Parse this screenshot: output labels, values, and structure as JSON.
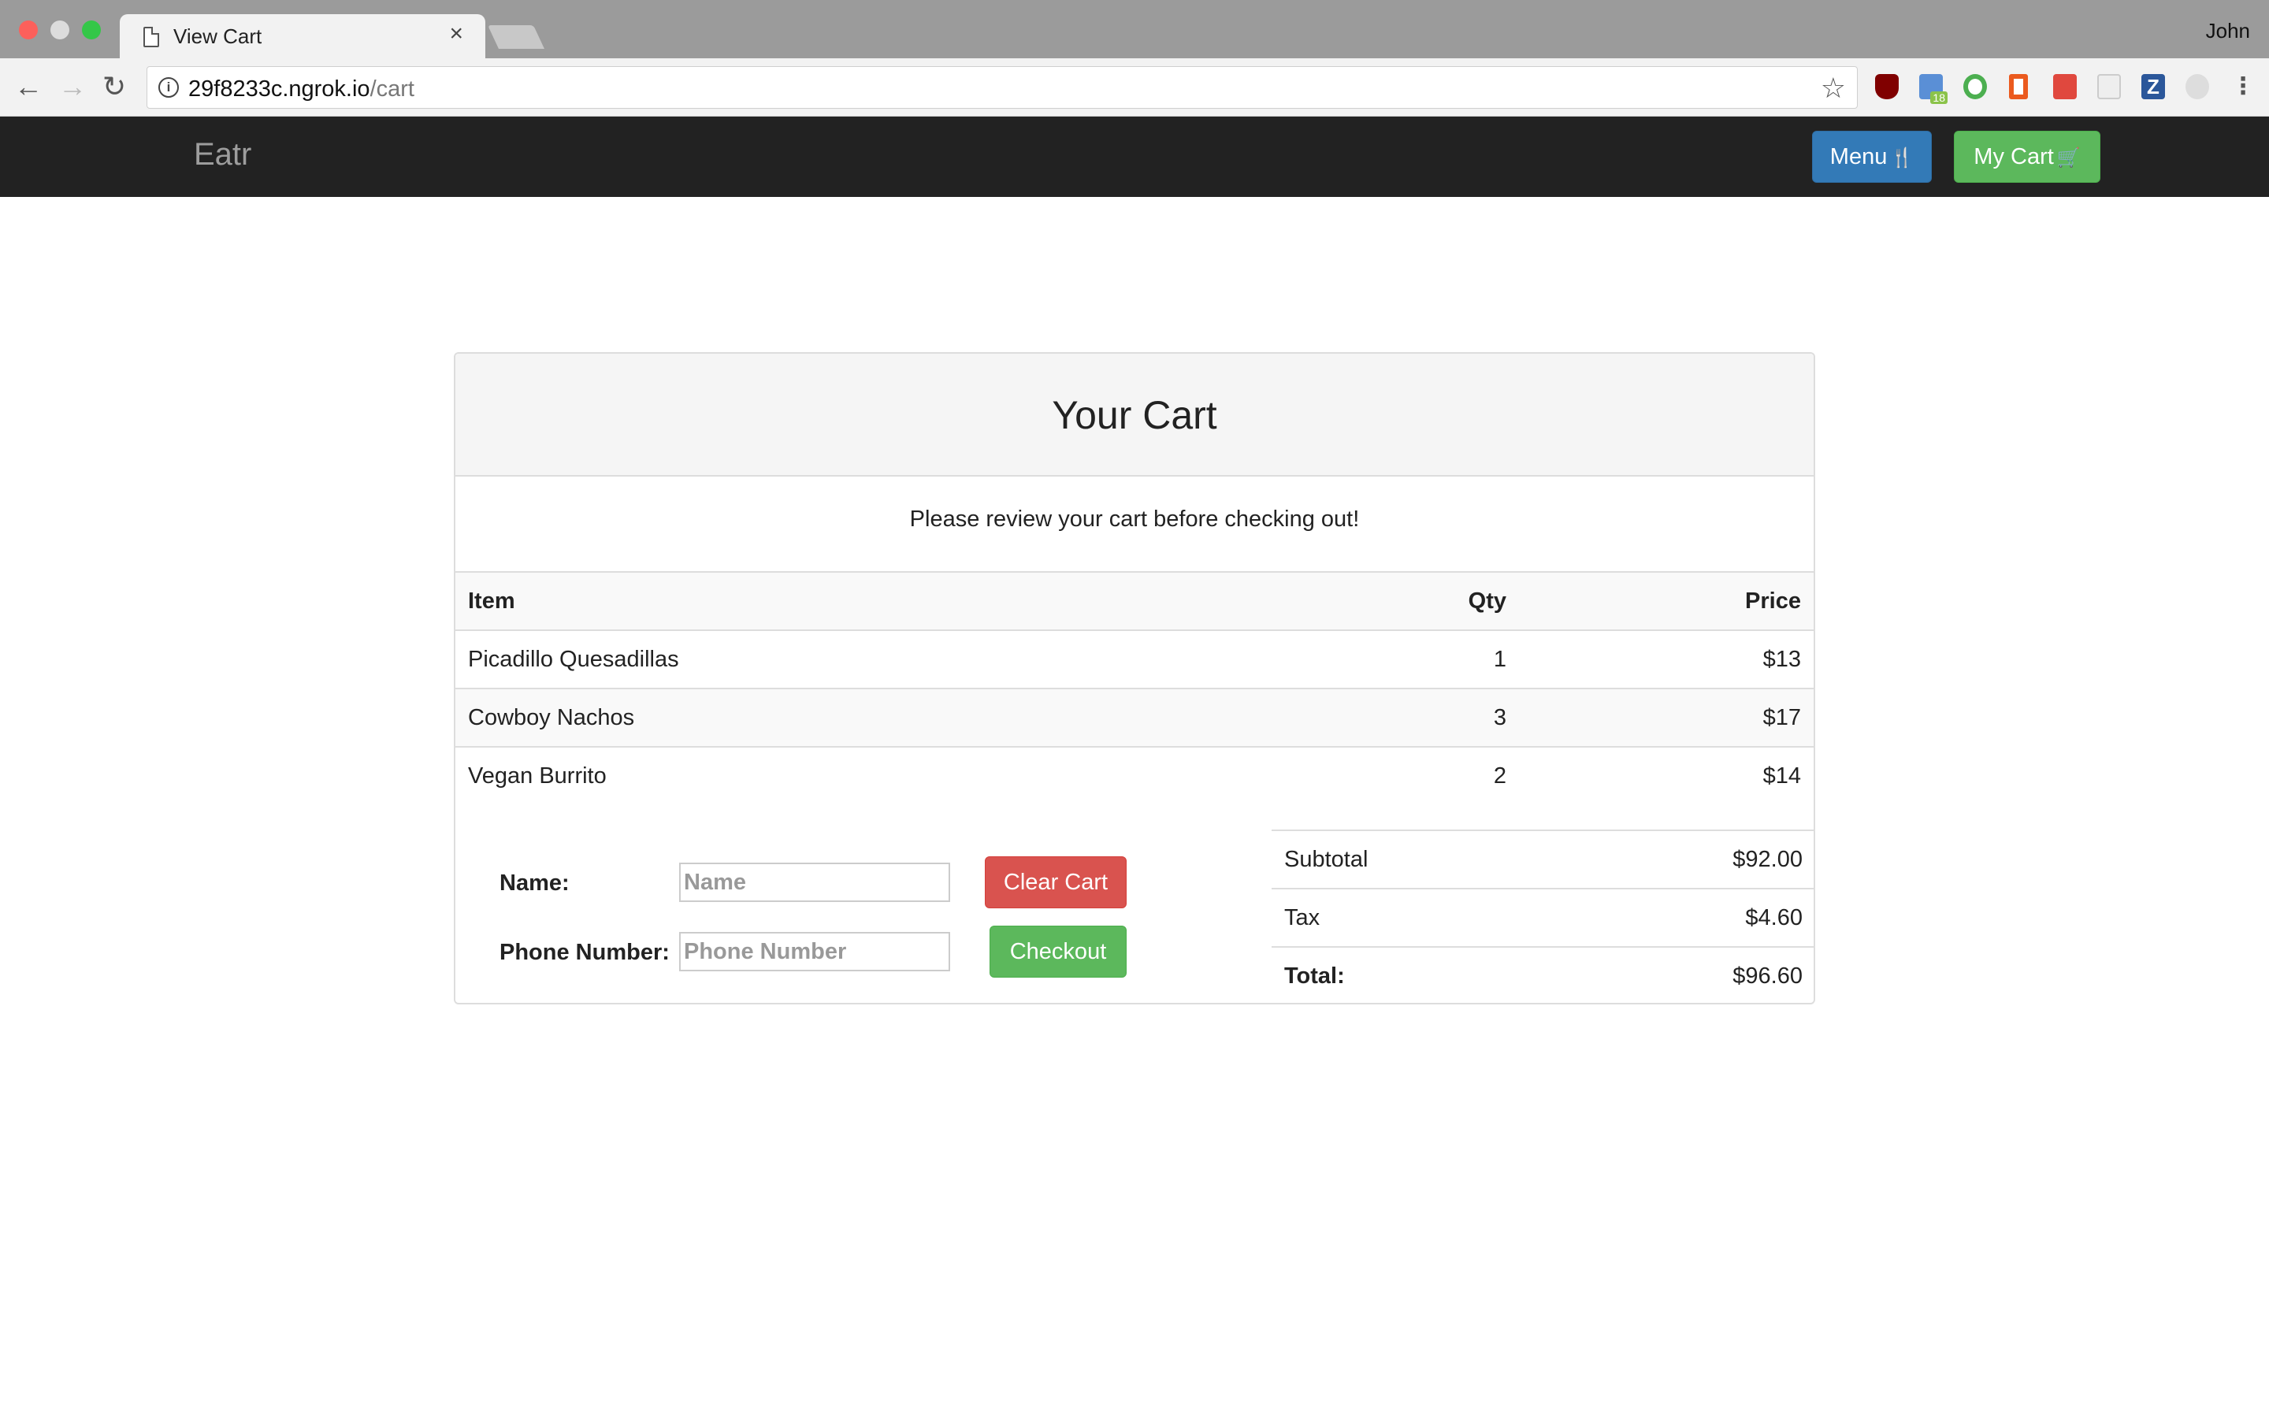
{
  "browser": {
    "tab_title": "View Cart",
    "tab_close": "×",
    "user": "John",
    "url_host": "29f8233c.ngrok.io",
    "url_path": "/cart",
    "extensions": [
      "ublock-icon",
      "calendar-icon",
      "ring-icon",
      "office-icon",
      "search-ext-icon",
      "blank-ext-icon",
      "z-ext-icon",
      "grey-ext-icon",
      "menu-kebab-icon"
    ],
    "calendar_badge": "18",
    "z_label": "Z"
  },
  "site": {
    "brand": "Eatr",
    "menu_label": "Menu",
    "mycart_label": "My Cart",
    "colors": {
      "menu": "#337ab7",
      "cart": "#5cb85c",
      "danger": "#d9534f",
      "navbar": "#222222"
    }
  },
  "cart": {
    "title": "Your Cart",
    "subtitle": "Please review your cart before checking out!",
    "columns": {
      "item": "Item",
      "qty": "Qty",
      "price": "Price"
    },
    "rows": [
      {
        "item": "Picadillo Quesadillas",
        "qty": "1",
        "price": "$13"
      },
      {
        "item": "Cowboy Nachos",
        "qty": "3",
        "price": "$17"
      },
      {
        "item": "Vegan Burrito",
        "qty": "2",
        "price": "$14"
      }
    ]
  },
  "form": {
    "name_label": "Name:",
    "name_placeholder": "Name",
    "phone_label": "Phone Number:",
    "phone_placeholder": "Phone Number",
    "clear_label": "Clear Cart",
    "checkout_label": "Checkout"
  },
  "totals": {
    "subtotal_label": "Subtotal",
    "subtotal": "$92.00",
    "tax_label": "Tax",
    "tax": "$4.60",
    "total_label": "Total:",
    "total": "$96.60"
  }
}
